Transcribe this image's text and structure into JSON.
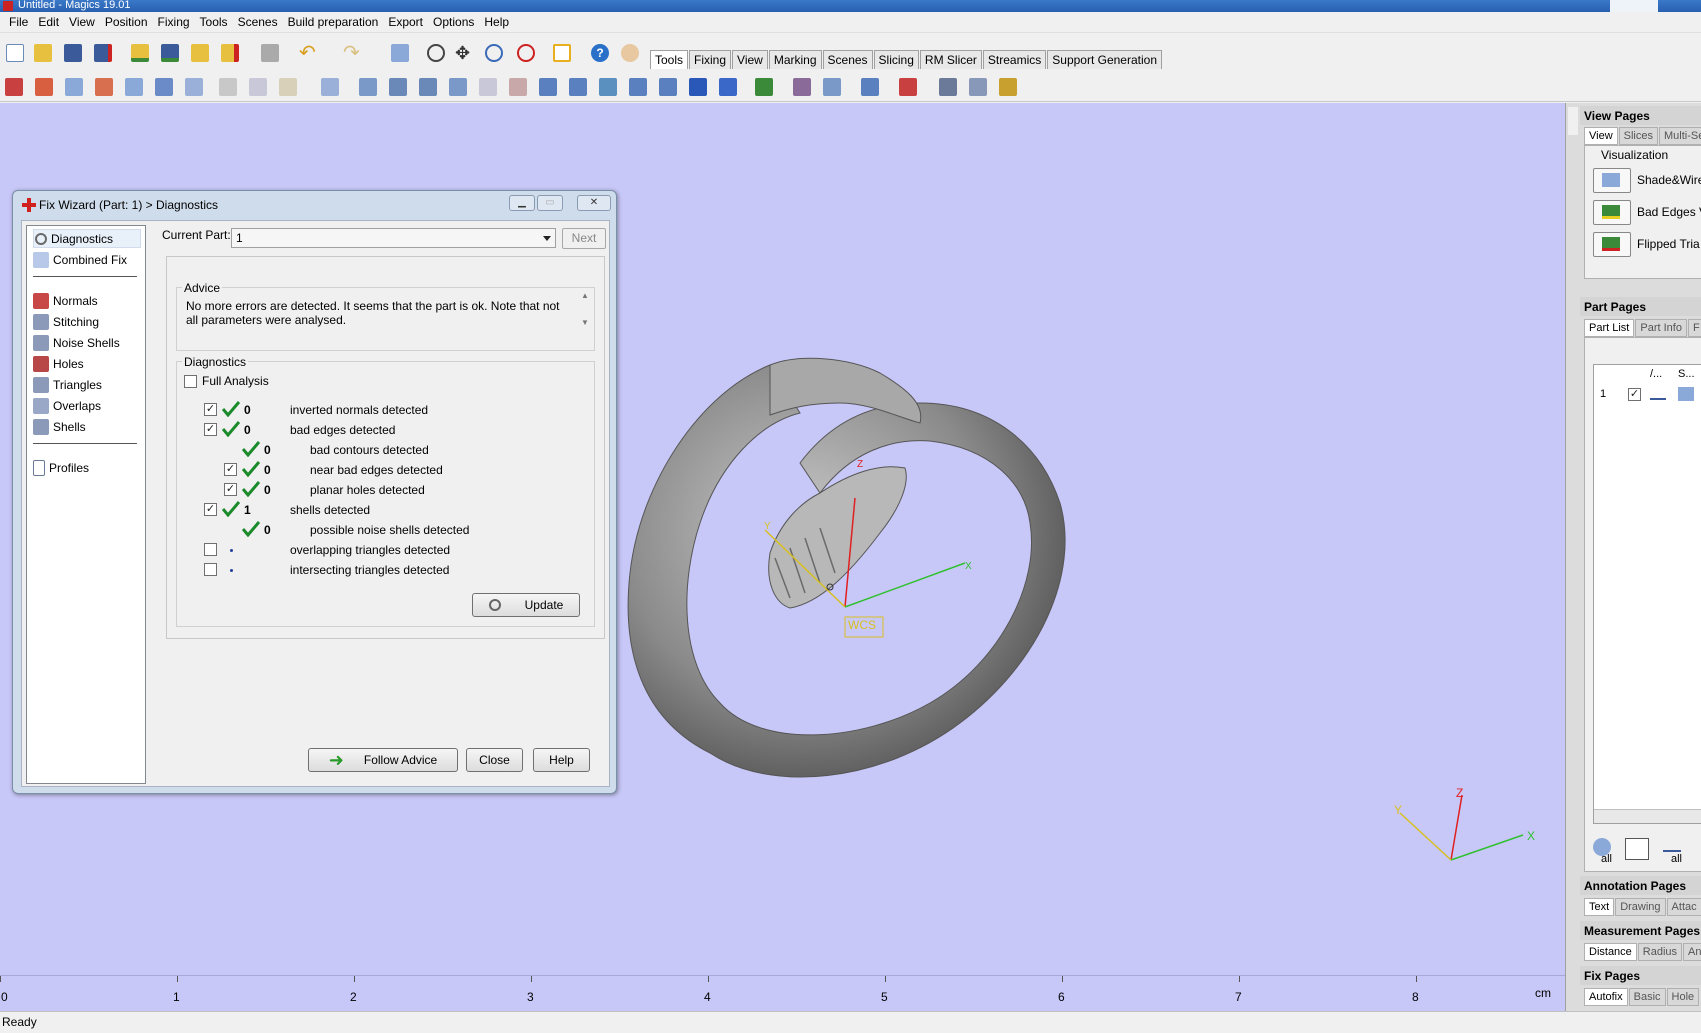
{
  "window": {
    "title": "Untitled - Magics 19.01"
  },
  "menu": [
    "File",
    "Edit",
    "View",
    "Position",
    "Fixing",
    "Tools",
    "Scenes",
    "Build preparation",
    "Export",
    "Options",
    "Help"
  ],
  "toolbar_tabs": [
    "Tools",
    "Fixing",
    "View",
    "Marking",
    "Scenes",
    "Slicing",
    "RM Slicer",
    "Streamics",
    "Support Generation"
  ],
  "dialog": {
    "title": "Fix Wizard (Part: 1) > Diagnostics",
    "nav": {
      "top": [
        "Diagnostics",
        "Combined Fix"
      ],
      "middle": [
        "Normals",
        "Stitching",
        "Noise Shells",
        "Holes",
        "Triangles",
        "Overlaps",
        "Shells"
      ],
      "bottom": [
        "Profiles"
      ]
    },
    "current_part_label": "Current Part:",
    "current_part_value": "1",
    "next_label": "Next",
    "advice_label": "Advice",
    "advice_text": "No more errors are detected. It seems that the part is ok. Note that not all parameters were analysed.",
    "diagnostics_label": "Diagnostics",
    "full_analysis_label": "Full Analysis",
    "rows": [
      {
        "count": "0",
        "text": "inverted normals detected"
      },
      {
        "count": "0",
        "text": "bad edges detected"
      },
      {
        "count": "0",
        "text": "bad contours detected"
      },
      {
        "count": "0",
        "text": "near bad edges detected"
      },
      {
        "count": "0",
        "text": "planar holes detected"
      },
      {
        "count": "1",
        "text": "shells detected"
      },
      {
        "count": "0",
        "text": "possible noise shells detected"
      },
      {
        "count": "",
        "text": "overlapping triangles detected"
      },
      {
        "count": "",
        "text": "intersecting triangles detected"
      }
    ],
    "update_label": "Update",
    "follow_advice_label": "Follow Advice",
    "close_label": "Close",
    "help_label": "Help"
  },
  "viewport": {
    "wcs_label": "WCS",
    "axis_x": "X",
    "axis_y": "Y",
    "axis_z": "Z",
    "ruler_labels": [
      "0",
      "1",
      "2",
      "3",
      "4",
      "5",
      "6",
      "7",
      "8"
    ],
    "ruler_unit": "cm"
  },
  "right_panel": {
    "view_pages": "View Pages",
    "view_tabs": [
      "View",
      "Slices",
      "Multi-Se"
    ],
    "visualization": "Visualization",
    "vis_items": [
      "Shade&Wire",
      "Bad Edges V",
      "Flipped Tria"
    ],
    "part_pages": "Part Pages",
    "part_tabs": [
      "Part List",
      "Part Info",
      "F"
    ],
    "part_cols": [
      "/...",
      "S..."
    ],
    "part_row_index": "1",
    "part_bottom_labels": [
      "all",
      "all"
    ],
    "annotation_pages": "Annotation Pages",
    "annotation_tabs": [
      "Text",
      "Drawing",
      "Attac"
    ],
    "measurement_pages": "Measurement Pages",
    "measurement_tabs": [
      "Distance",
      "Radius",
      "An"
    ],
    "fix_pages": "Fix Pages",
    "fix_tabs": [
      "Autofix",
      "Basic",
      "Hole"
    ]
  },
  "status": {
    "text": "Ready"
  },
  "colors": {
    "viewport_bg": "#c8c8f8",
    "check_green": "#1a8a2a",
    "axis_x": "#30c030",
    "axis_y": "#d8c020",
    "axis_z": "#e02020"
  }
}
